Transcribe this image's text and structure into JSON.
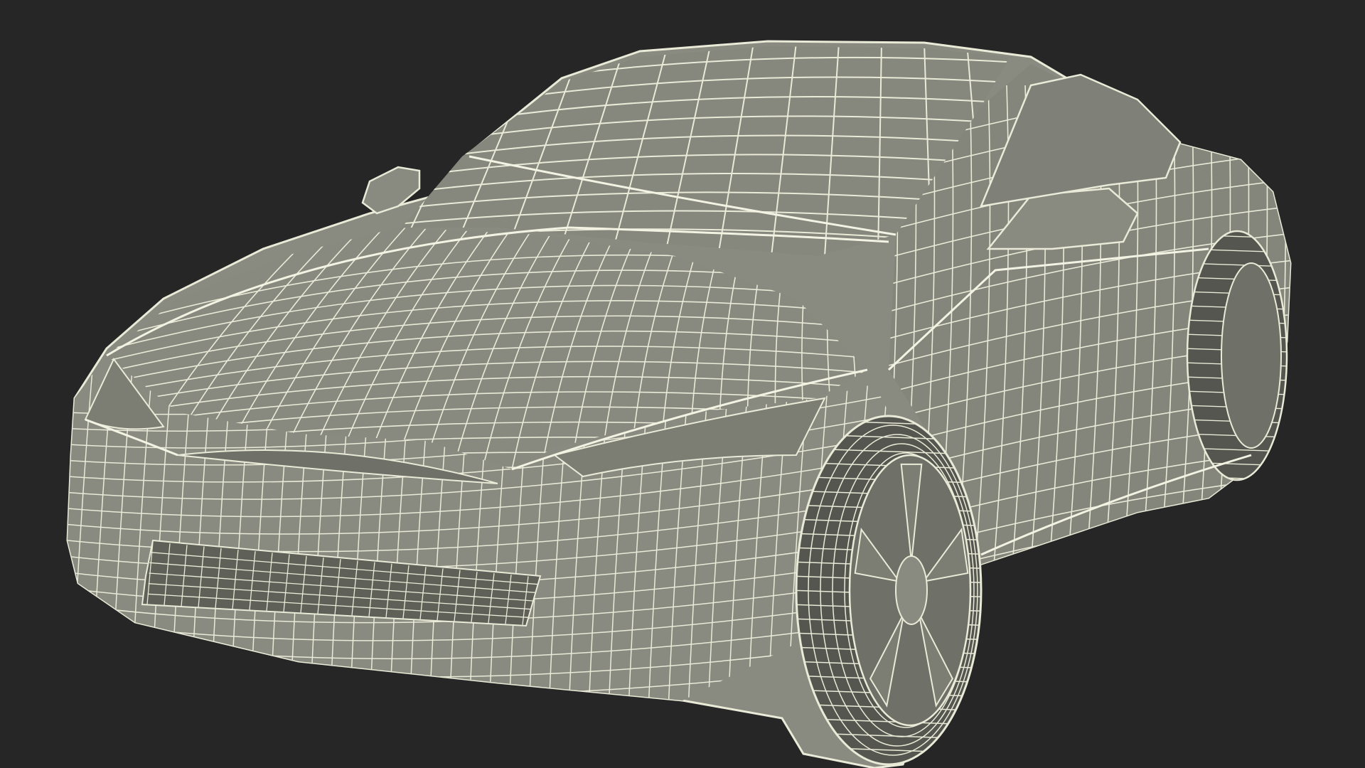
{
  "scene": {
    "subject": "car-wireframe-render",
    "colors": {
      "background": "#262626",
      "body_fill": "#8a8b80",
      "body_shadow": "#6f7068",
      "wire": "#e9ead7",
      "glass_fill": "#7f8077",
      "tire_fill": "#55564f",
      "grille_fill": "#5f6058"
    }
  }
}
